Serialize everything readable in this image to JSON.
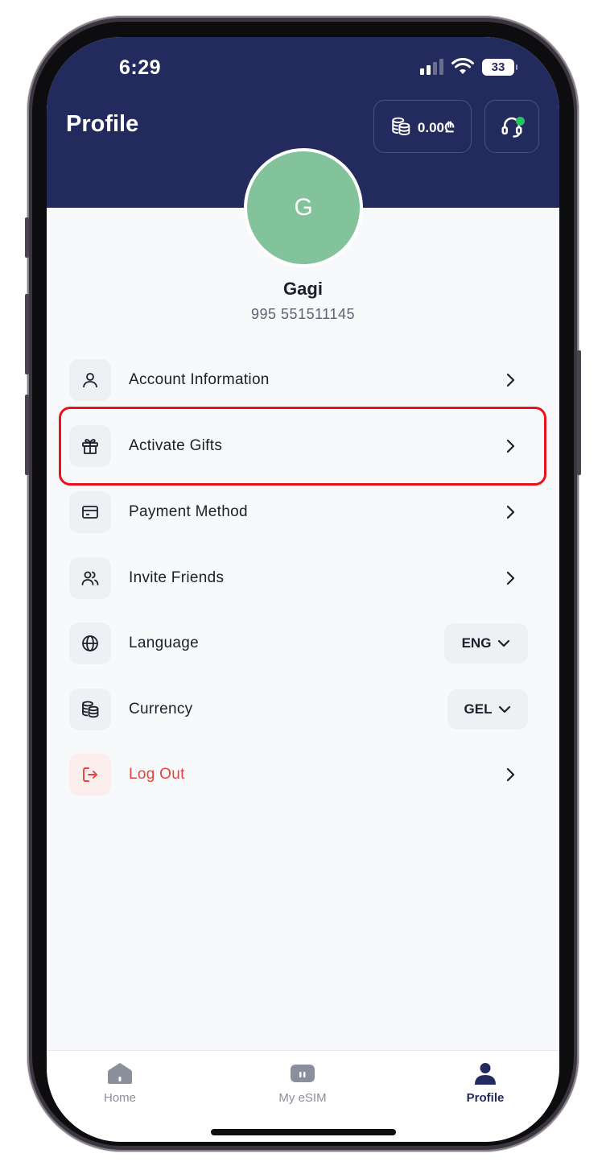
{
  "status_bar": {
    "time": "6:29",
    "battery": "33"
  },
  "header": {
    "title": "Profile",
    "balance": "0.00₾"
  },
  "user": {
    "initial": "G",
    "name": "Gagi",
    "phone": "995 551511145"
  },
  "menu": [
    {
      "label": "Account Information",
      "icon": "user-icon"
    },
    {
      "label": "Activate Gifts",
      "icon": "gift-icon"
    },
    {
      "label": "Payment Method",
      "icon": "credit-card-icon"
    },
    {
      "label": "Invite Friends",
      "icon": "users-icon"
    },
    {
      "label": "Language",
      "icon": "globe-icon",
      "value": "ENG"
    },
    {
      "label": "Currency",
      "icon": "coins-icon",
      "value": "GEL"
    },
    {
      "label": "Log Out",
      "icon": "logout-icon"
    }
  ],
  "tabs": [
    {
      "label": "Home",
      "icon": "home-icon"
    },
    {
      "label": "My eSIM",
      "icon": "sim-icon"
    },
    {
      "label": "Profile",
      "icon": "person-icon",
      "active": true
    }
  ],
  "colors": {
    "header_bg": "#232b5e",
    "avatar_bg": "#82c39c",
    "danger": "#e5433b",
    "highlight_border": "#e8131c",
    "online": "#22c55e"
  }
}
